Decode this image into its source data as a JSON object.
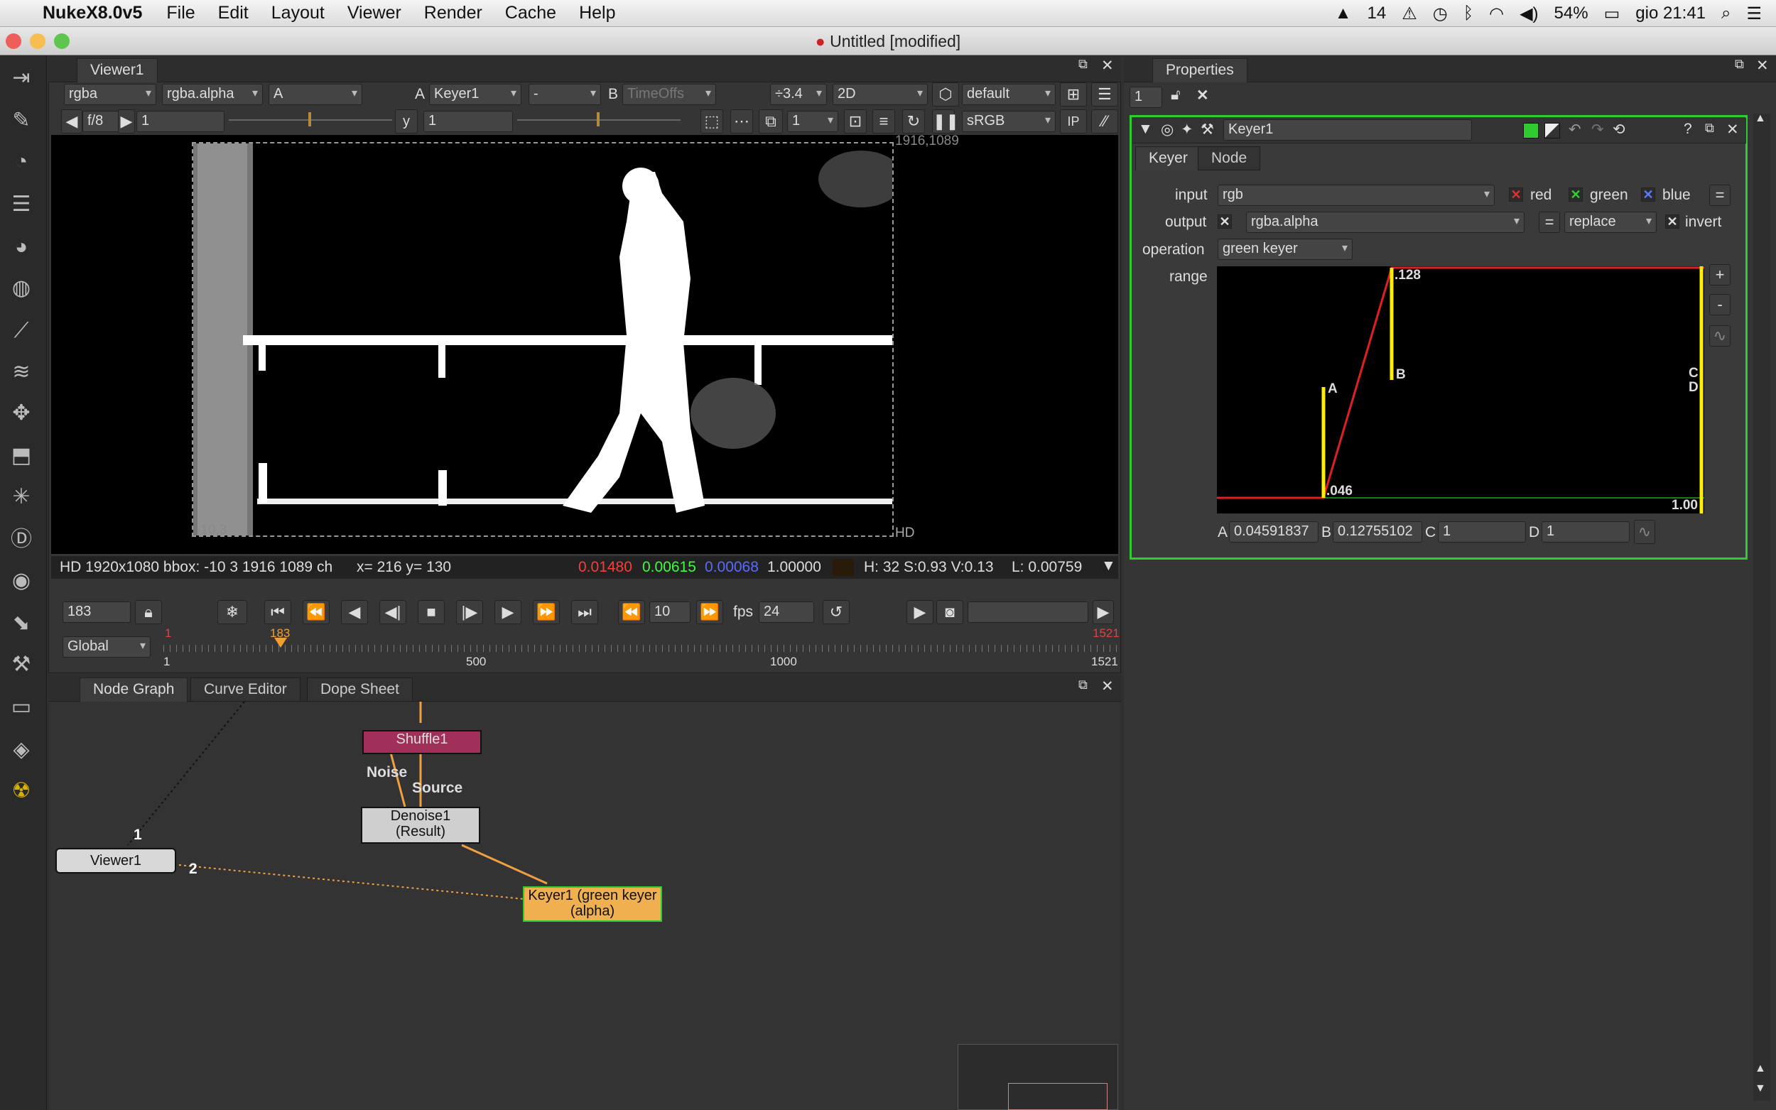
{
  "menubar": {
    "app": "NukeX8.0v5",
    "items": [
      "File",
      "Edit",
      "Layout",
      "Viewer",
      "Render",
      "Cache",
      "Help"
    ],
    "status": {
      "notif": "14",
      "battery": "54%",
      "clock": "gio 21:41"
    }
  },
  "window": {
    "title": "Untitled [modified]"
  },
  "viewer": {
    "tab": "Viewer1",
    "channels": "rgba",
    "alpha_channel": "rgba.alpha",
    "a_select": "A",
    "a_label": "A",
    "a_input": "Keyer1",
    "mode": "-",
    "b_label": "B",
    "b_input": "TimeOffs",
    "zoom": "÷3.4",
    "view_mode": "2D",
    "lut": "default",
    "fstop": "f/8",
    "gain": "1",
    "gamma_label": "y",
    "gamma": "1",
    "proxy": "1",
    "colorspace": "sRGB",
    "corner_tr": "1916,1089",
    "corner_bl": "-10,3",
    "format_label": "HD",
    "info": {
      "format": "HD 1920x1080 bbox: -10 3 1916 1089 ch",
      "coords": "x= 216 y= 130",
      "r": "0.01480",
      "g": "0.00615",
      "b": "0.00068",
      "a": "1.00000",
      "hsv": "H: 32 S:0.93 V:0.13",
      "lum": "L: 0.00759"
    }
  },
  "timeline": {
    "frame": "183",
    "increment": "10",
    "fps_label": "fps",
    "fps": "24",
    "scope": "Global",
    "start": "1",
    "end": "1521",
    "current": "183",
    "ticks": [
      "1",
      "500",
      "1000",
      "1521"
    ]
  },
  "nodegraph": {
    "tabs": [
      "Node Graph",
      "Curve Editor",
      "Dope Sheet"
    ],
    "nodes": {
      "shuffle": "Shuffle1",
      "denoise1": "Denoise1",
      "denoise2": "(Result)",
      "keyer1": "Keyer1 (green keyer",
      "keyer2": "(alpha)",
      "viewer": "Viewer1"
    },
    "edge_labels": {
      "noise": "Noise",
      "source": "Source",
      "in1": "1",
      "in2": "2"
    }
  },
  "properties": {
    "title": "Properties",
    "max_panels": "1",
    "node_name": "Keyer1",
    "tabs": [
      "Keyer",
      "Node"
    ],
    "input_label": "input",
    "input": "rgb",
    "red": "red",
    "green": "green",
    "blue": "blue",
    "output_label": "output",
    "output": "rgba.alpha",
    "output_op": "replace",
    "invert": "invert",
    "operation_label": "operation",
    "operation": "green keyer",
    "range_label": "range",
    "range_marks": {
      "a": "A",
      "b": "B",
      "c": "C",
      "d": "D",
      "v_a": ".046",
      "v_b": ".128",
      "v_d": "1.00"
    },
    "values": {
      "a_label": "A",
      "a": "0.04591837",
      "b_label": "B",
      "b": "0.12755102",
      "c_label": "C",
      "c": "1",
      "d_label": "D",
      "d": "1"
    }
  },
  "colors": {
    "keyer_border": "#2ecc2e",
    "shuffle": "#a0305a",
    "keyer_node": "#f0b050",
    "edge": "#f0a040"
  }
}
